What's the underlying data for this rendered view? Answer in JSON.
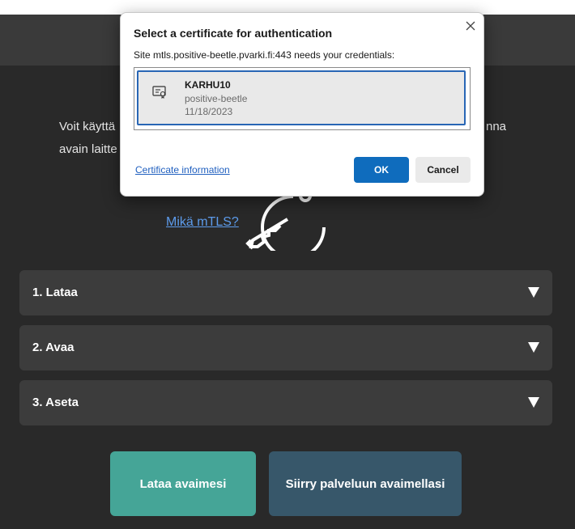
{
  "intro": {
    "line1_start": "Voit käyttä",
    "line1_end": "nna",
    "line2_start": "avain laitte"
  },
  "mtls_link": "Mikä mTLS?",
  "accordions": [
    {
      "label": "1. Lataa"
    },
    {
      "label": "2. Avaa"
    },
    {
      "label": "3. Aseta"
    }
  ],
  "buttons": {
    "download_key": "Lataa avaimesi",
    "go_to_service": "Siirry palveluun avaimellasi"
  },
  "dialog": {
    "title": "Select a certificate for authentication",
    "subtitle": "Site mtls.positive-beetle.pvarki.fi:443 needs your credentials:",
    "certificate": {
      "name": "KARHU10",
      "issuer": "positive-beetle",
      "date": "11/18/2023",
      "icon": "certificate-icon"
    },
    "certificate_info_link": "Certificate information",
    "ok_label": "OK",
    "cancel_label": "Cancel"
  },
  "colors": {
    "background": "#292929",
    "accordion": "#3c3c3c",
    "download_button": "#45a597",
    "goto_button": "#37576a",
    "link": "#5d9cec",
    "dialog_primary": "#0f6cbd"
  }
}
